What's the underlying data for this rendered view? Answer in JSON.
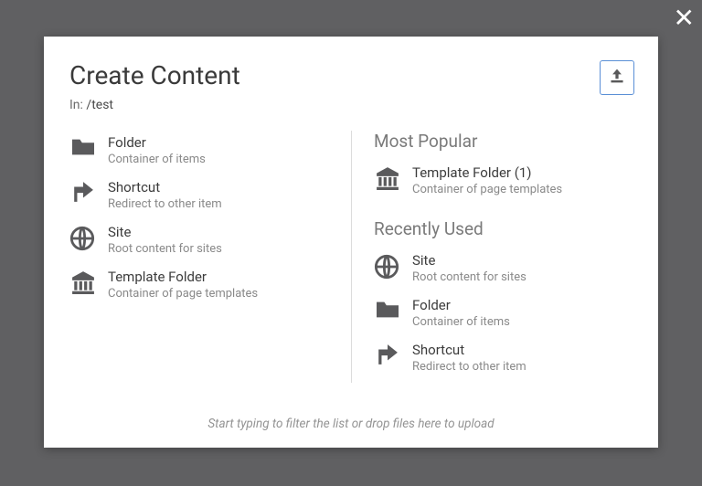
{
  "modal": {
    "title": "Create Content",
    "path_prefix": "In:",
    "path": "/test",
    "hint": "Start typing to filter the list or drop files here to upload",
    "items": [
      {
        "label": "Folder",
        "desc": "Container of items"
      },
      {
        "label": "Shortcut",
        "desc": "Redirect to other item"
      },
      {
        "label": "Site",
        "desc": "Root content for sites"
      },
      {
        "label": "Template Folder",
        "desc": "Container of page templates"
      }
    ],
    "most_popular_heading": "Most Popular",
    "most_popular": [
      {
        "label": "Template Folder (1)",
        "desc": "Container of page templates"
      }
    ],
    "recently_used_heading": "Recently Used",
    "recently_used": [
      {
        "label": "Site",
        "desc": "Root content for sites"
      },
      {
        "label": "Folder",
        "desc": "Container of items"
      },
      {
        "label": "Shortcut",
        "desc": "Redirect to other item"
      }
    ]
  }
}
